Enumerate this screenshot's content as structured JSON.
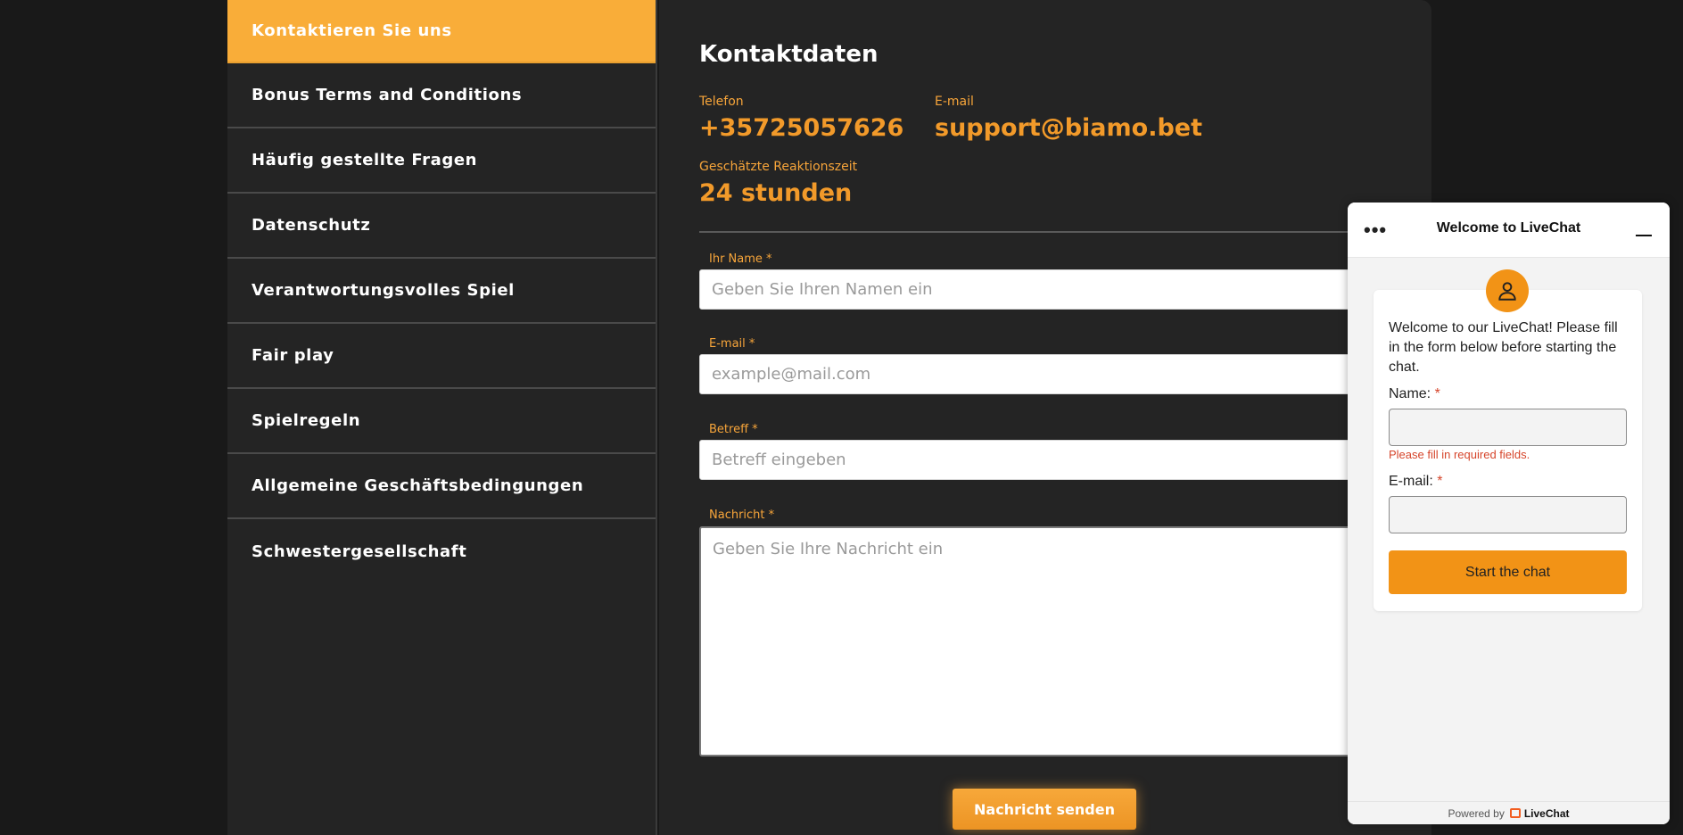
{
  "sidebar": {
    "items": [
      {
        "label": "Kontaktieren Sie uns",
        "active": true
      },
      {
        "label": "Bonus Terms and Conditions"
      },
      {
        "label": "Häufig gestellte Fragen"
      },
      {
        "label": "Datenschutz"
      },
      {
        "label": "Verantwortungsvolles Spiel"
      },
      {
        "label": "Fair play"
      },
      {
        "label": "Spielregeln"
      },
      {
        "label": "Allgemeine Geschäftsbedingungen"
      },
      {
        "label": "Schwestergesellschaft"
      }
    ]
  },
  "main": {
    "title": "Kontaktdaten",
    "phone_label": "Telefon",
    "phone_value": "+35725057626",
    "email_label": "E-mail",
    "email_value": "support@biamo.bet",
    "response_label": "Geschätzte Reaktionszeit",
    "response_value": "24 stunden",
    "form": {
      "name_label": "Ihr Name *",
      "name_placeholder": "Geben Sie Ihren Namen ein",
      "email_label": "E-mail *",
      "email_placeholder": "example@mail.com",
      "subject_label": "Betreff *",
      "subject_placeholder": "Betreff eingeben",
      "message_label": "Nachricht *",
      "message_placeholder": "Geben Sie Ihre Nachricht ein",
      "send_label": "Nachricht senden"
    }
  },
  "chat": {
    "menu_dots": "•••",
    "title": "Welcome to LiveChat",
    "welcome": "Welcome to our LiveChat! Please fill in the form below before starting the chat.",
    "name_label": "Name:",
    "email_label": "E-mail:",
    "required_mark": "*",
    "error": "Please fill in required fields.",
    "start_label": "Start the chat",
    "powered_by": "Powered by",
    "brand": "LiveChat"
  },
  "colors": {
    "accent": "#f9ad39",
    "value_orange": "#f29a2a",
    "chat_orange": "#f29316",
    "background": "#191919",
    "panel": "#242424"
  }
}
